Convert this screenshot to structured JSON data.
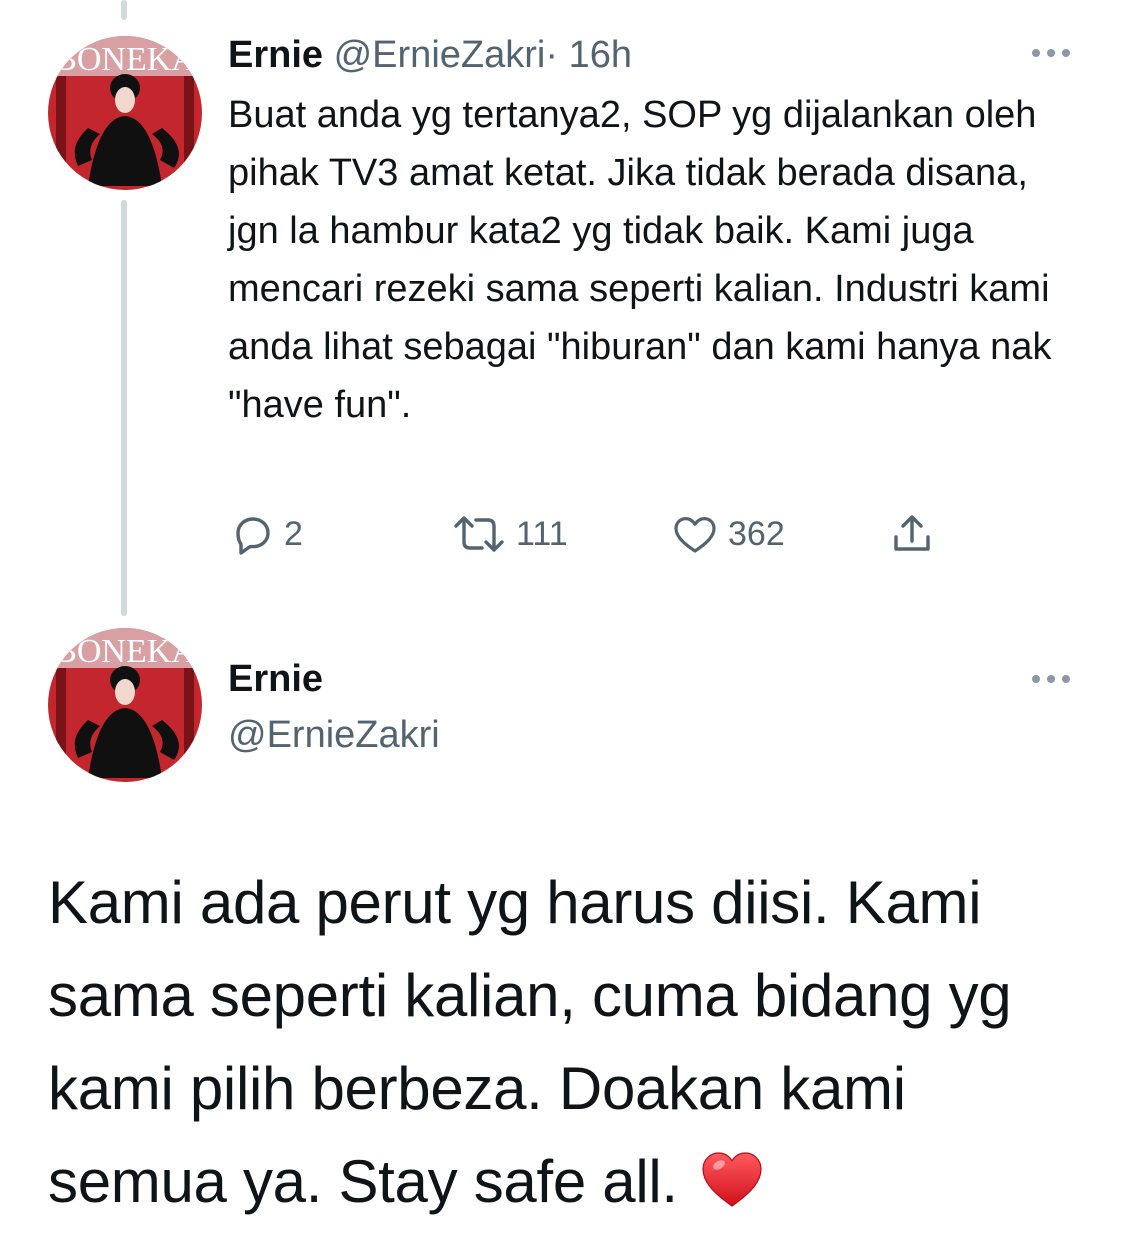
{
  "tweet": {
    "name": "Ernie",
    "handle": "@ErnieZakri",
    "separator": "·",
    "time": "16h",
    "text": "Buat anda yg tertanya2, SOP yg dijalankan oleh pihak TV3 amat ketat. Jika tidak berada disana, jgn la hambur kata2 yg tidak baik. Kami juga mencari rezeki sama seperti kalian. Industri kami anda lihat sebagai \"hiburan\" dan kami hanya nak \"have fun\".",
    "replies": "2",
    "retweets": "111",
    "likes": "362",
    "avatar_text": "BONEKA"
  },
  "reply": {
    "name": "Ernie",
    "handle": "@ErnieZakri",
    "text": "Kami ada perut yg harus diisi. Kami sama seperti kalian, cuma bidang yg kami pilih berbeza. Doakan kami semua ya. Stay safe all.",
    "emoji": "❤️",
    "avatar_text": "BONEKA"
  },
  "icons": {
    "reply": "reply-icon",
    "retweet": "retweet-icon",
    "like": "heart-icon",
    "share": "share-icon",
    "more": "more-icon"
  },
  "colors": {
    "text": "#0f1419",
    "muted": "#536471",
    "thread_line": "#cfd9de",
    "heart_emoji": "#e0245e"
  }
}
